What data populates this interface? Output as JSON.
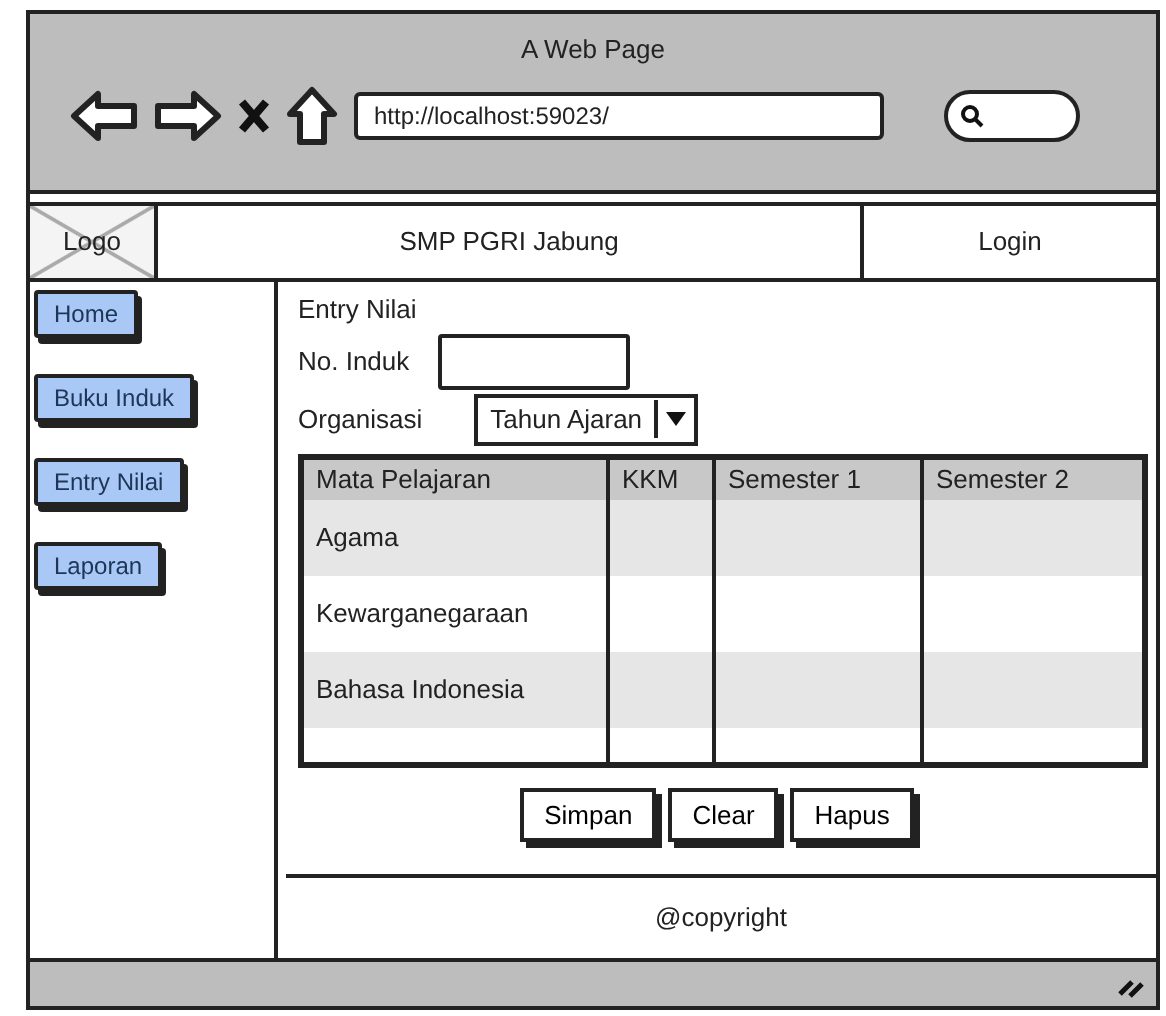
{
  "window": {
    "title": "A Web Page",
    "url": "http://localhost:59023/"
  },
  "header": {
    "logo": "Logo",
    "title": "SMP PGRI Jabung",
    "login": "Login"
  },
  "sidebar": {
    "items": [
      {
        "label": "Home"
      },
      {
        "label": "Buku Induk"
      },
      {
        "label": "Entry Nilai"
      },
      {
        "label": "Laporan"
      }
    ]
  },
  "form": {
    "title": "Entry Nilai",
    "no_induk_label": "No. Induk",
    "organisasi_label": "Organisasi",
    "organisasi_value": "Tahun Ajaran"
  },
  "table": {
    "columns": [
      "Mata Pelajaran",
      "KKM",
      "Semester 1",
      "Semester 2"
    ],
    "rows": [
      [
        "Agama",
        "",
        "",
        ""
      ],
      [
        "Kewarganegaraan",
        "",
        "",
        ""
      ],
      [
        "Bahasa Indonesia",
        "",
        "",
        ""
      ]
    ]
  },
  "buttons": [
    "Simpan",
    "Clear",
    "Hapus"
  ],
  "footer": "@copyright"
}
